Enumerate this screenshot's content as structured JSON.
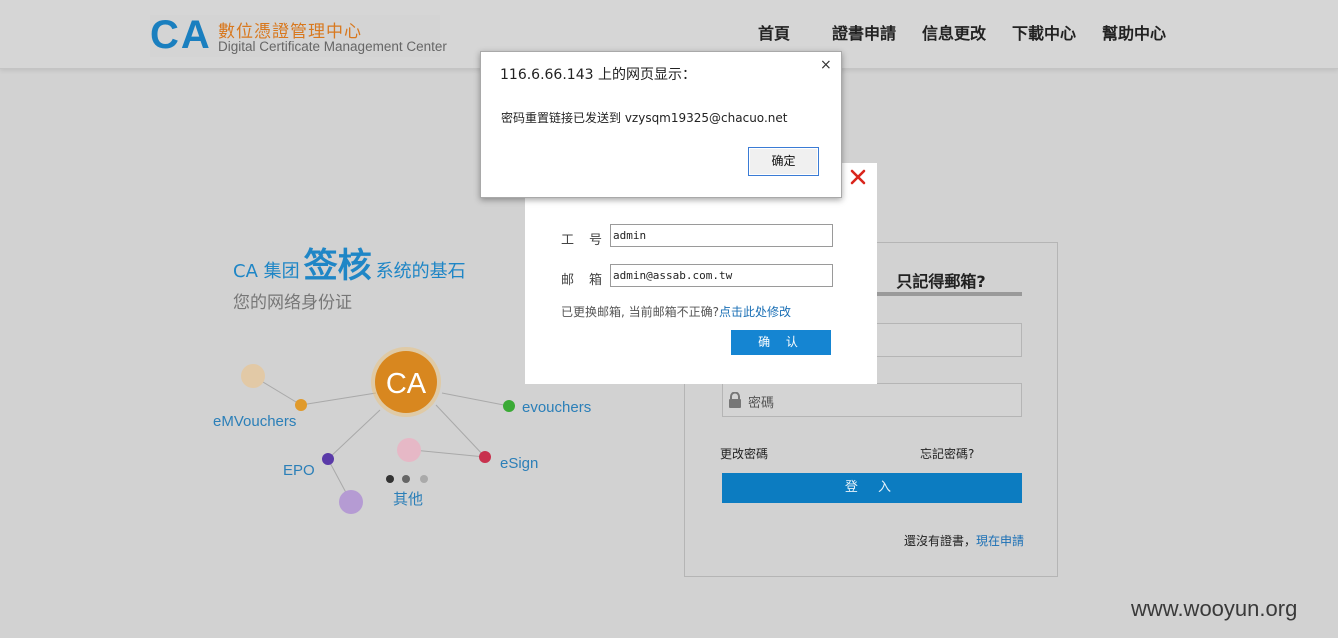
{
  "header": {
    "logo": {
      "mark": "CA",
      "name_zh": "數位憑證管理中心",
      "name_en": "Digital Certificate Management Center"
    },
    "nav": [
      "首頁",
      "證書申請",
      "信息更改",
      "下載中心",
      "幫助中心"
    ]
  },
  "hero": {
    "tagline_pre": "CA 集团",
    "tagline_big": "签核",
    "tagline_post": "系统的基石",
    "subtitle": "您的网络身份证",
    "center": "CA",
    "nodes": [
      "eMVouchers",
      "evouchers",
      "EPO",
      "eSign",
      "其他"
    ]
  },
  "login": {
    "tab": "只記得郵箱?",
    "password_placeholder": "密碼",
    "change_password": "更改密碼",
    "forgot_password": "忘記密碼?",
    "submit": "登 入",
    "no_cert": "還沒有證書，",
    "apply_now": "現在申請"
  },
  "modal": {
    "id_label": "工　号",
    "id_value": "admin",
    "email_label": "邮　箱",
    "email_value": "admin@assab.com.tw",
    "hint": "已更换邮箱, 当前邮箱不正确?",
    "hint_link": "点击此处修改",
    "confirm": "确 认"
  },
  "alert": {
    "title": "116.6.66.143 上的网页显示：",
    "message": "密码重置链接已发送到 vzysqm19325@chacuo.net",
    "ok": "确定",
    "close": "×"
  },
  "watermark": "www.wooyun.org",
  "colors": {
    "brand_blue": "#1f86c6",
    "brand_orange": "#d8781e",
    "button_blue": "#0c7cc1",
    "close_red": "#d9251c"
  }
}
